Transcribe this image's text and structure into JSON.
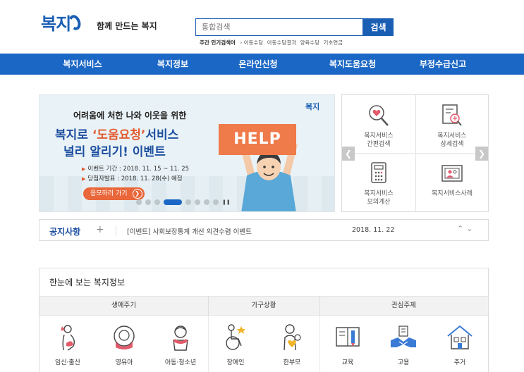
{
  "header": {
    "logo_text": "복지",
    "tagline": "함께 만드는 복지",
    "search_placeholder": "통합검색",
    "search_button": "검색",
    "popular_label": "주간 인기검색어",
    "popular_items": [
      "아동수당",
      "아동수당결과",
      "양육수당",
      "기초연금"
    ]
  },
  "nav": {
    "items": [
      "복지서비스",
      "복지정보",
      "온라인신청",
      "복지도움요청",
      "부정수급신고"
    ]
  },
  "banner": {
    "subtitle": "어려움에 처한 나와 이웃을 위한",
    "title_pre": "복지로 ",
    "title_highlight": "‘도움요청’",
    "title_post": "서비스",
    "title_line2": "널리 알리기! 이벤트",
    "period": "이벤트 기간 : 2018. 11. 15 ~ 11. 25",
    "announce": "당첨자발표 : 2018. 11. 28(수) 예정",
    "cta": "응모하러 가기",
    "sign": "HELP",
    "logo": "복지"
  },
  "quick_menu": {
    "items": [
      {
        "line1": "복지서비스",
        "line2": "간편검색"
      },
      {
        "line1": "복지서비스",
        "line2": "상세검색"
      },
      {
        "line1": "복지서비스",
        "line2": "모의계산"
      },
      {
        "line1": "복지서비스사례",
        "line2": ""
      }
    ]
  },
  "notice": {
    "title": "공지사항",
    "text": "[이벤트] 사회보장통계 개선 의견수렴 이벤트",
    "date": "2018. 11. 22"
  },
  "info": {
    "title": "한눈에 보는 복지정보",
    "groups": [
      "생애주기",
      "가구상황",
      "관심주제"
    ],
    "items": [
      "임신·출산",
      "영유아",
      "아동·청소년",
      "장애인",
      "한부모",
      "교육",
      "고용",
      "주거"
    ]
  },
  "colors": {
    "brand_blue": "#1b67c5",
    "accent_orange": "#e9673a"
  }
}
